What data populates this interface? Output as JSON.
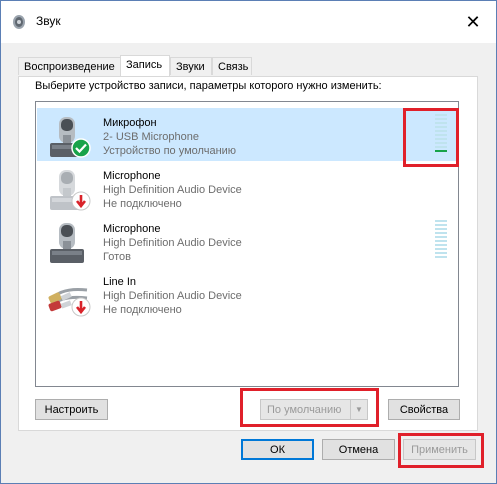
{
  "window": {
    "title": "Звук",
    "close_glyph": "✕"
  },
  "tabs": [
    {
      "label": "Воспроизведение",
      "active": false
    },
    {
      "label": "Запись",
      "active": true
    },
    {
      "label": "Звуки",
      "active": false
    },
    {
      "label": "Связь",
      "active": false
    }
  ],
  "panel": {
    "instruction": "Выберите устройство записи, параметры которого нужно изменить:"
  },
  "devices": [
    {
      "name": "Микрофон",
      "description": "2- USB Microphone",
      "status": "Устройство по умолчанию",
      "badge": "check-icon",
      "selected": true,
      "level": 0.1
    },
    {
      "name": "Microphone",
      "description": "High Definition Audio Device",
      "status": "Не подключено",
      "badge": "down-arrow-icon",
      "selected": false
    },
    {
      "name": "Microphone",
      "description": "High Definition Audio Device",
      "status": "Готов",
      "badge": "",
      "selected": false,
      "level": 0
    },
    {
      "name": "Line In",
      "description": "High Definition Audio Device",
      "status": "Не подключено",
      "badge": "down-arrow-icon",
      "selected": false
    }
  ],
  "buttons": {
    "configure": "Настроить",
    "set_default": "По умолчанию",
    "properties": "Свойства",
    "ok": "ОК",
    "cancel": "Отмена",
    "apply": "Применить"
  },
  "colors": {
    "selection": "#cce8ff",
    "highlight": "#e0202a",
    "level_on": "#19a34a",
    "check": "#19a34a",
    "arrow": "#d9232a"
  }
}
